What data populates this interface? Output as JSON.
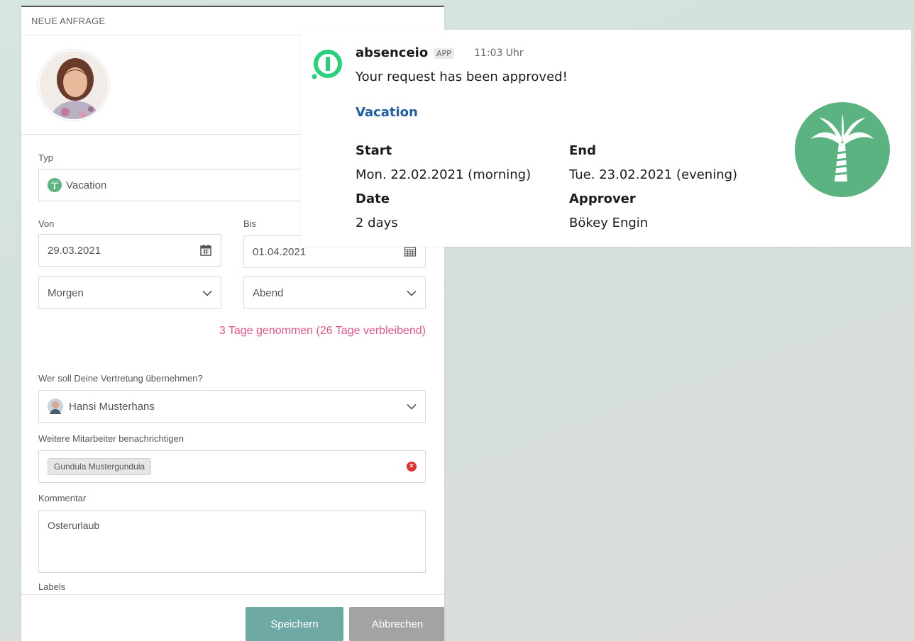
{
  "form": {
    "header": "NEUE ANFRAGE",
    "type_label": "Typ",
    "type_value": "Vacation",
    "from_label": "Von",
    "to_label": "Bis",
    "from_date": "29.03.2021",
    "to_date": "01.04.2021",
    "from_period": "Morgen",
    "to_period": "Abend",
    "days_taken": "3 Tage genommen (26 Tage verbleibend)",
    "substitute_label": "Wer soll Deine Vertretung übernehmen?",
    "substitute_value": "Hansi Musterhans",
    "notify_label": "Weitere Mitarbeiter benachrichtigen",
    "notify_chip": "Gundula Mustergundula",
    "comment_label": "Kommentar",
    "comment_value": "Osterurlaub",
    "labels_label": "Labels",
    "save_label": "Speichern",
    "cancel_label": "Abbrechen"
  },
  "notification": {
    "app_name": "absenceio",
    "badge": "APP",
    "time": "11:03 Uhr",
    "message": "Your request has been approved!",
    "title": "Vacation",
    "start_label": "Start",
    "start_value": "Mon. 22.02.2021 (morning)",
    "end_label": "End",
    "end_value": "Tue. 23.02.2021 (evening)",
    "date_label": "Date",
    "date_value": "2 days",
    "approver_label": "Approver",
    "approver_value": "Bökey Engin"
  },
  "colors": {
    "accent_pink": "#e8558a",
    "save_button": "#6fa9a6",
    "cancel_button": "#a3a3a3",
    "app_green": "#2bd17a",
    "palm_green": "#5bb382",
    "slack_link": "#1d5fa0"
  },
  "icons": [
    "palm-tree-icon",
    "calendar-icon",
    "chevron-down-icon",
    "clear-icon",
    "absenceio-logo-icon"
  ]
}
